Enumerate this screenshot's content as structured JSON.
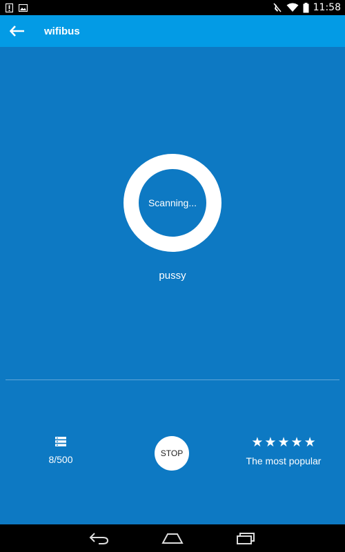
{
  "status_bar": {
    "time": "11:58",
    "left_icons": [
      "alert-icon",
      "image-icon"
    ],
    "right_icons": [
      "mute-icon",
      "wifi-icon",
      "battery-icon"
    ]
  },
  "app_bar": {
    "title": "wifibus",
    "back_icon": "arrow-left-icon",
    "color": "#039be5"
  },
  "main": {
    "background": "#0d79c3",
    "ring_text": "Scanning...",
    "network_name": "pussy",
    "count": "8/500",
    "count_icon": "server-list-icon",
    "stop_label": "STOP",
    "rating_stars": 5,
    "popular_label": "The most popular"
  },
  "nav_bar": {
    "items": [
      "back-icon",
      "home-icon",
      "recents-icon"
    ]
  }
}
